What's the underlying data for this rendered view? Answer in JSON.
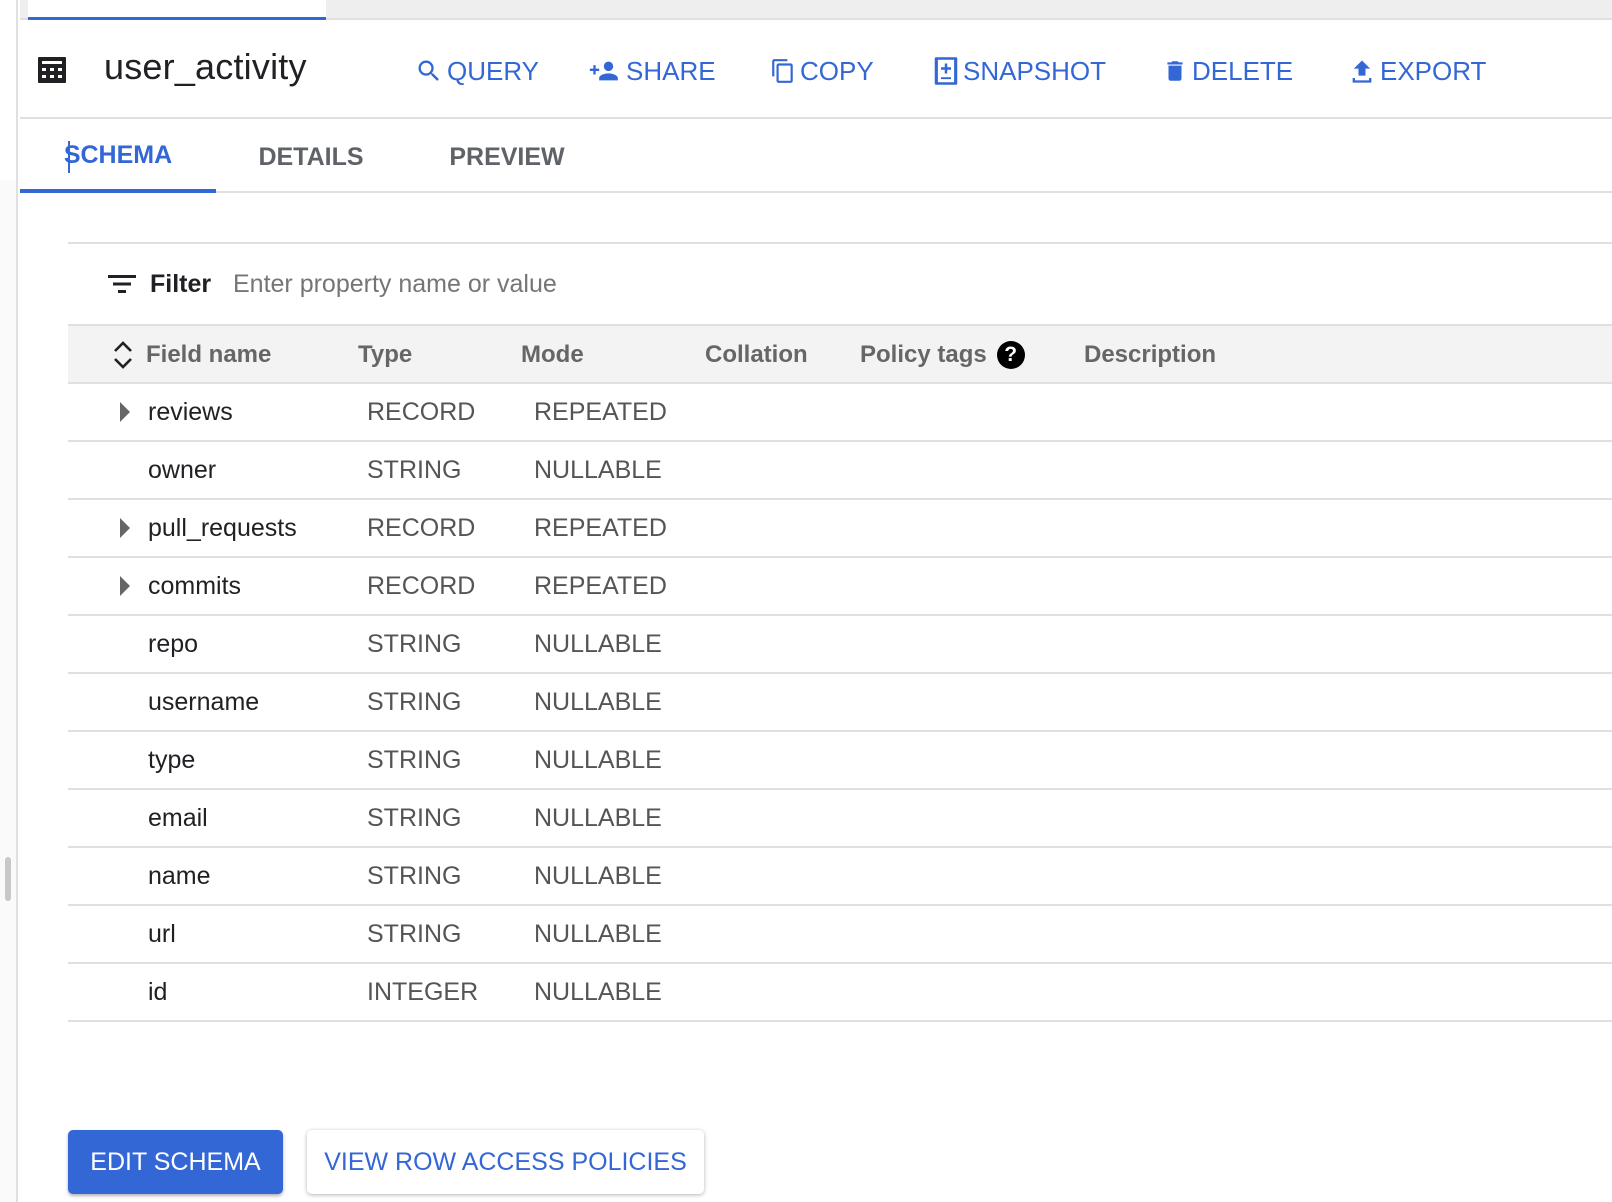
{
  "header": {
    "title": "user_activity",
    "icon": "table-grid-icon",
    "actions": [
      {
        "label": "QUERY",
        "icon": "search-icon"
      },
      {
        "label": "SHARE",
        "icon": "person-add-icon"
      },
      {
        "label": "COPY",
        "icon": "copy-icon"
      },
      {
        "label": "SNAPSHOT",
        "icon": "snapshot-icon"
      },
      {
        "label": "DELETE",
        "icon": "trash-icon"
      },
      {
        "label": "EXPORT",
        "icon": "upload-icon"
      }
    ]
  },
  "tabs": [
    {
      "label": "SCHEMA",
      "active": true
    },
    {
      "label": "DETAILS",
      "active": false
    },
    {
      "label": "PREVIEW",
      "active": false
    }
  ],
  "filter": {
    "label": "Filter",
    "placeholder": "Enter property name or value",
    "value": ""
  },
  "table": {
    "columns": [
      "Field name",
      "Type",
      "Mode",
      "Collation",
      "Policy tags",
      "Description"
    ],
    "policy_tags_help": "?",
    "rows": [
      {
        "name": "reviews",
        "type": "RECORD",
        "mode": "REPEATED",
        "expandable": true
      },
      {
        "name": "owner",
        "type": "STRING",
        "mode": "NULLABLE",
        "expandable": false
      },
      {
        "name": "pull_requests",
        "type": "RECORD",
        "mode": "REPEATED",
        "expandable": true
      },
      {
        "name": "commits",
        "type": "RECORD",
        "mode": "REPEATED",
        "expandable": true
      },
      {
        "name": "repo",
        "type": "STRING",
        "mode": "NULLABLE",
        "expandable": false
      },
      {
        "name": "username",
        "type": "STRING",
        "mode": "NULLABLE",
        "expandable": false
      },
      {
        "name": "type",
        "type": "STRING",
        "mode": "NULLABLE",
        "expandable": false
      },
      {
        "name": "email",
        "type": "STRING",
        "mode": "NULLABLE",
        "expandable": false
      },
      {
        "name": "name",
        "type": "STRING",
        "mode": "NULLABLE",
        "expandable": false
      },
      {
        "name": "url",
        "type": "STRING",
        "mode": "NULLABLE",
        "expandable": false
      },
      {
        "name": "id",
        "type": "INTEGER",
        "mode": "NULLABLE",
        "expandable": false
      }
    ]
  },
  "buttons": {
    "edit_schema": "EDIT SCHEMA",
    "view_row_access": "VIEW ROW ACCESS POLICIES"
  },
  "colors": {
    "accent": "#3367d6",
    "header_bg": "#f3f3f3",
    "divider": "#e0e0e0"
  }
}
